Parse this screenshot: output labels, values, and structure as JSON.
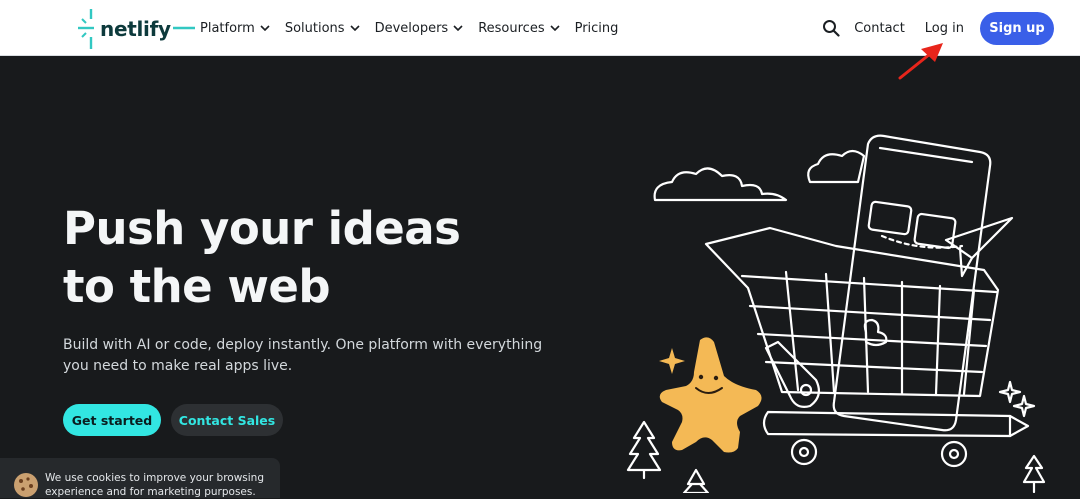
{
  "header": {
    "logo_text": "netlify",
    "nav": [
      {
        "label": "Platform",
        "has_dropdown": true
      },
      {
        "label": "Solutions",
        "has_dropdown": true
      },
      {
        "label": "Developers",
        "has_dropdown": true
      },
      {
        "label": "Resources",
        "has_dropdown": true
      },
      {
        "label": "Pricing",
        "has_dropdown": false
      }
    ],
    "search_icon": "search-icon",
    "contact_label": "Contact",
    "login_label": "Log in",
    "signup_label": "Sign up"
  },
  "hero": {
    "title_lines": [
      "Push your ideas",
      "to the web"
    ],
    "subtitle_lines": [
      "Build with AI or code, deploy instantly. One platform with everything",
      "you need to make real apps live."
    ],
    "primary_cta": "Get started",
    "secondary_cta": "Contact Sales"
  },
  "cookie": {
    "text_lines": [
      "We use cookies to improve your browsing",
      "experience and for marketing purposes."
    ]
  },
  "colors": {
    "hero_bg": "#181a1c",
    "brand_teal": "#32e6e2",
    "signup_blue": "#3a5fe8",
    "annotation_red": "#e8251b",
    "mascot_yellow": "#f4b955"
  }
}
